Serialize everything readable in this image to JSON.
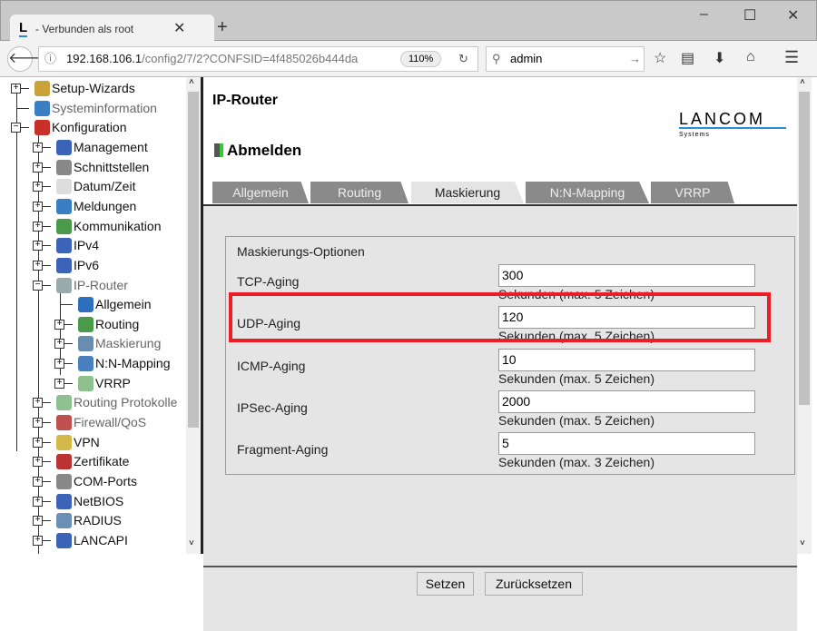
{
  "browser": {
    "tab_title": "- Verbunden als root",
    "url_host": "192.168.106.1",
    "url_path": "/config2/7/2?CONFSID=4f485026b444da",
    "zoom": "110%",
    "search_value": "admin"
  },
  "tree": [
    {
      "label": "Setup-Wizards",
      "level": 0,
      "exp": "+",
      "icon": "wand-icon",
      "color": "#c9a23a"
    },
    {
      "label": "Systeminformation",
      "level": 0,
      "exp": "",
      "icon": "info-icon",
      "color": "#3a7fc4",
      "dim": true
    },
    {
      "label": "Konfiguration",
      "level": 0,
      "exp": "-",
      "icon": "tools-icon",
      "color": "#c8302a"
    },
    {
      "label": "Management",
      "level": 1,
      "exp": "+",
      "icon": "management-icon",
      "color": "#3b64b8"
    },
    {
      "label": "Schnittstellen",
      "level": 1,
      "exp": "+",
      "icon": "interface-icon",
      "color": "#888"
    },
    {
      "label": "Datum/Zeit",
      "level": 1,
      "exp": "+",
      "icon": "clock-icon",
      "color": "#ddd"
    },
    {
      "label": "Meldungen",
      "level": 1,
      "exp": "+",
      "icon": "info-icon",
      "color": "#3a7fc4"
    },
    {
      "label": "Kommunikation",
      "level": 1,
      "exp": "+",
      "icon": "communication-icon",
      "color": "#4a9a4a"
    },
    {
      "label": "IPv4",
      "level": 1,
      "exp": "+",
      "icon": "network-icon",
      "color": "#3b64b8"
    },
    {
      "label": "IPv6",
      "level": 1,
      "exp": "+",
      "icon": "network-icon",
      "color": "#3b64b8"
    },
    {
      "label": "IP-Router",
      "level": 1,
      "exp": "-",
      "icon": "router-icon",
      "color": "#9aa",
      "dim": true
    },
    {
      "label": "Allgemein",
      "level": 2,
      "exp": "",
      "icon": "cubes-icon",
      "color": "#2f6fbf"
    },
    {
      "label": "Routing",
      "level": 2,
      "exp": "+",
      "icon": "communication-icon",
      "color": "#4a9a4a"
    },
    {
      "label": "Maskierung",
      "level": 2,
      "exp": "+",
      "icon": "mask-icon",
      "color": "#6a8cae",
      "dim": true
    },
    {
      "label": "N:N-Mapping",
      "level": 2,
      "exp": "+",
      "icon": "mapping-icon",
      "color": "#4a80c0"
    },
    {
      "label": "VRRP",
      "level": 2,
      "exp": "+",
      "icon": "vrrp-icon",
      "color": "#8fc08f"
    },
    {
      "label": "Routing Protokolle",
      "level": 1,
      "exp": "+",
      "icon": "vrrp-icon",
      "color": "#8fc08f",
      "dim": true
    },
    {
      "label": "Firewall/QoS",
      "level": 1,
      "exp": "+",
      "icon": "firewall-icon",
      "color": "#c0504d",
      "dim": true
    },
    {
      "label": "VPN",
      "level": 1,
      "exp": "+",
      "icon": "lock-icon",
      "color": "#d4b94a"
    },
    {
      "label": "Zertifikate",
      "level": 1,
      "exp": "+",
      "icon": "certificate-icon",
      "color": "#b33"
    },
    {
      "label": "COM-Ports",
      "level": 1,
      "exp": "+",
      "icon": "interface-icon",
      "color": "#888"
    },
    {
      "label": "NetBIOS",
      "level": 1,
      "exp": "+",
      "icon": "network-icon",
      "color": "#3b64b8"
    },
    {
      "label": "RADIUS",
      "level": 1,
      "exp": "+",
      "icon": "server-icon",
      "color": "#6b8fb5"
    },
    {
      "label": "LANCAPI",
      "level": 1,
      "exp": "+",
      "icon": "network-icon",
      "color": "#3b64b8"
    }
  ],
  "page": {
    "title": "IP-Router",
    "logo": "LANCOM",
    "logo_sub": "Systems",
    "logout": "Abmelden",
    "tabs": [
      {
        "label": "Allgemein"
      },
      {
        "label": "Routing"
      },
      {
        "label": "Maskierung",
        "active": true
      },
      {
        "label": "N:N-Mapping"
      },
      {
        "label": "VRRP"
      }
    ],
    "legend": "Maskierungs-Optionen",
    "fields": [
      {
        "label": "TCP-Aging",
        "value": "300",
        "hint": "Sekunden (max. 5 Zeichen)"
      },
      {
        "label": "UDP-Aging",
        "value": "120",
        "hint": "Sekunden (max. 5 Zeichen)",
        "highlighted": true
      },
      {
        "label": "ICMP-Aging",
        "value": "10",
        "hint": "Sekunden (max. 5 Zeichen)"
      },
      {
        "label": "IPSec-Aging",
        "value": "2000",
        "hint": "Sekunden (max. 5 Zeichen)"
      },
      {
        "label": "Fragment-Aging",
        "value": "5",
        "hint": "Sekunden (max. 3 Zeichen)"
      }
    ],
    "set_button": "Setzen",
    "reset_button": "Zurücksetzen"
  },
  "colors": {
    "highlight": "#ee1c25",
    "logo_accent": "#2a8fd0"
  }
}
